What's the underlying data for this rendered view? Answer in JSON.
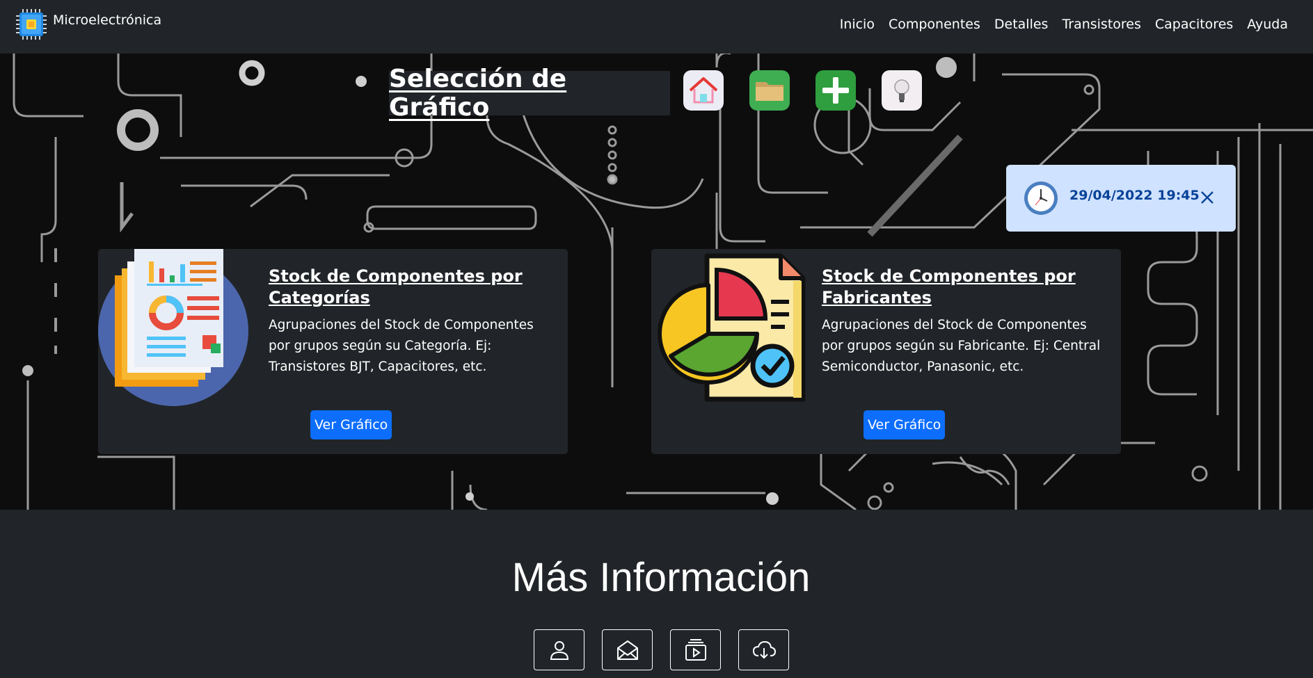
{
  "navbar": {
    "brand": "Microelectrónica",
    "links": [
      "Inicio",
      "Componentes",
      "Detalles",
      "Transistores",
      "Capacitores",
      "Ayuda"
    ]
  },
  "hero": {
    "title": "Selección de Gráfico",
    "icons": [
      "home-icon",
      "folder-icon",
      "add-icon",
      "lightbulb-icon"
    ]
  },
  "toast": {
    "datetime": "29/04/2022 19:45",
    "icon": "clock-icon"
  },
  "cards": [
    {
      "title": "Stock de Componentes por Categorías",
      "text": "Agrupaciones del Stock de Componentes por grupos según su Categoría. Ej: Transistores BJT, Capacitores, etc.",
      "button": "Ver Gráfico",
      "image": "report-document-icon"
    },
    {
      "title": "Stock de Componentes por Fabricantes",
      "text": "Agrupaciones del Stock de Componentes por grupos según su Fabricante. Ej: Central Semiconductor, Panasonic, etc.",
      "button": "Ver Gráfico",
      "image": "pie-chart-document-icon"
    }
  ],
  "info": {
    "title": "Más Información",
    "buttons": [
      "person-icon",
      "envelope-open-icon",
      "media-play-icon",
      "cloud-download-icon"
    ]
  },
  "colors": {
    "navbar_bg": "#212529",
    "primary": "#0d6efd",
    "toast_bg": "#cfe2ff",
    "toast_text": "#084298"
  }
}
